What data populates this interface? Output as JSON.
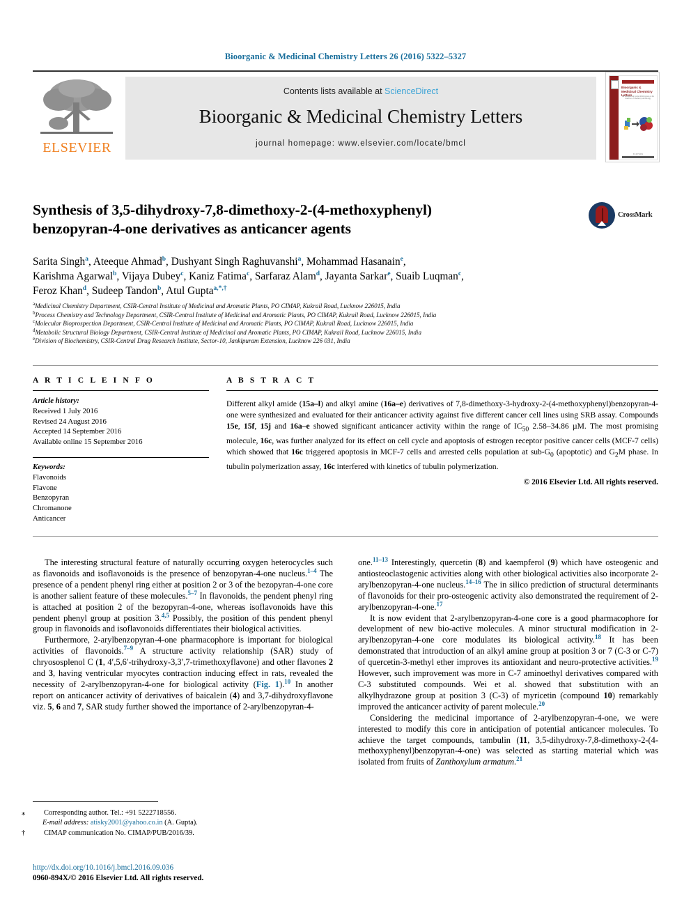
{
  "running_head": "Bioorganic & Medicinal Chemistry Letters 26 (2016) 5322–5327",
  "masthead": {
    "publisher": "ELSEVIER",
    "contents_prefix": "Contents lists available at ",
    "sciencedirect": "ScienceDirect",
    "journal_title": "Bioorganic & Medicinal Chemistry Letters",
    "homepage": "journal homepage: www.elsevier.com/locate/bmcl",
    "cover": {
      "title": "Bioorganic & Medicinal Chemistry Letters",
      "subtitle": "An International Journal Publications on the Interface of Chemistry and Biology",
      "footer": "ELSEVIER"
    }
  },
  "crossmark": {
    "label": "CrossMark"
  },
  "article": {
    "title_line1": "Synthesis of 3,5-dihydroxy-7,8-dimethoxy-2-(4-methoxyphenyl)",
    "title_line2": "benzopyran-4-one derivatives as anticancer agents",
    "authors_line1": "Sarita Singh a, Ateeque Ahmad b, Dushyant Singh Raghuvanshi a, Mohammad Hasanain e,",
    "authors_line2": "Karishma Agarwal b, Vijaya Dubey c, Kaniz Fatima c, Sarfaraz Alam d, Jayanta Sarkar e, Suaib Luqman c,",
    "authors_line3": "Feroz Khan d, Sudeep Tandon b, Atul Gupta a,*,†",
    "affiliations": [
      {
        "mark": "a",
        "text": "Medicinal Chemistry Department, CSIR-Central Institute of Medicinal and Aromatic Plants, PO CIMAP, Kukrail Road, Lucknow 226015, India"
      },
      {
        "mark": "b",
        "text": "Process Chemistry and Technology Department, CSIR-Central Institute of Medicinal and Aromatic Plants, PO CIMAP, Kukrail Road, Lucknow 226015, India"
      },
      {
        "mark": "c",
        "text": "Molecular Bioprospection Department, CSIR-Central Institute of Medicinal and Aromatic Plants, PO CIMAP, Kukrail Road, Lucknow 226015, India"
      },
      {
        "mark": "d",
        "text": "Metabolic Structural Biology Department, CSIR-Central Institute of Medicinal and Aromatic Plants, PO CIMAP, Kukrail Road, Lucknow 226015, India"
      },
      {
        "mark": "e",
        "text": "Division of Biochemistry, CSIR-Central Drug Research Institute, Sector-10, Jankipuram Extension, Lucknow 226 031, India"
      }
    ]
  },
  "article_info": {
    "heading": "A R T I C L E   I N F O",
    "history_title": "Article history:",
    "history": [
      "Received 1 July 2016",
      "Revised 24 August 2016",
      "Accepted 14 September 2016",
      "Available online 15 September 2016"
    ],
    "keywords_title": "Keywords:",
    "keywords": [
      "Flavonoids",
      "Flavone",
      "Benzopyran",
      "Chromanone",
      "Anticancer"
    ]
  },
  "abstract": {
    "heading": "A B S T R A C T",
    "copyright": "© 2016 Elsevier Ltd. All rights reserved."
  },
  "footnotes": {
    "corresponding_sym": "⁎",
    "corresponding": "Corresponding author. Tel.: +91 5222718556.",
    "email_label": "E-mail address:",
    "email": "atisky2001@yahoo.co.in",
    "email_owner": "(A. Gupta).",
    "dagger_sym": "†",
    "cimap": "CIMAP communication No. CIMAP/PUB/2016/39.",
    "doi": "http://dx.doi.org/10.1016/j.bmcl.2016.09.036",
    "issn": "0960-894X/© 2016 Elsevier Ltd. All rights reserved."
  },
  "colors": {
    "link_blue": "#1a6f9c",
    "sciencedirect_blue": "#3ba3d6",
    "elsevier_orange": "#f08122",
    "band_grey": "#e7e7e7"
  }
}
